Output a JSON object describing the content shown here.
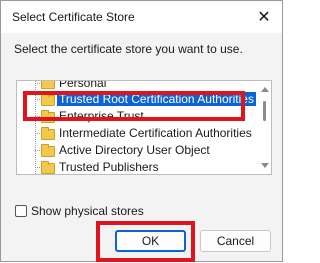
{
  "window": {
    "title": "Select Certificate Store",
    "close_glyph": "✕"
  },
  "instruction": "Select the certificate store you want to use.",
  "tree": {
    "items": [
      {
        "label": "Personal",
        "selected": false
      },
      {
        "label": "Trusted Root Certification Authorities",
        "selected": true
      },
      {
        "label": "Enterprise Trust",
        "selected": false
      },
      {
        "label": "Intermediate Certification Authorities",
        "selected": false
      },
      {
        "label": "Active Directory User Object",
        "selected": false
      },
      {
        "label": "Trusted Publishers",
        "selected": false
      }
    ]
  },
  "options": {
    "show_physical_label": "Show physical stores",
    "show_physical_checked": false
  },
  "buttons": {
    "ok_label": "OK",
    "cancel_label": "Cancel"
  },
  "colors": {
    "selection": "#0a64d6",
    "highlight": "#e0141c",
    "folder": "#f4c84a"
  }
}
